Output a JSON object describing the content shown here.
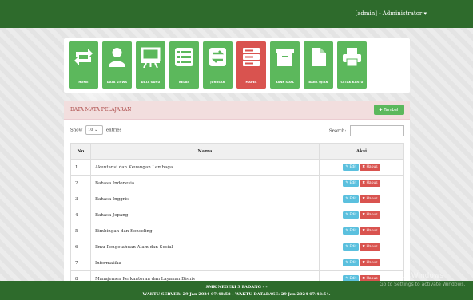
{
  "header": {
    "user_label": "[admin] - Administrator ▾"
  },
  "menu": [
    {
      "label": "HOME",
      "icon": "refresh-icon"
    },
    {
      "label": "DATA SISWA",
      "icon": "user-icon"
    },
    {
      "label": "DATA GURU",
      "icon": "presentation-icon"
    },
    {
      "label": "KELAS",
      "icon": "list-icon"
    },
    {
      "label": "JURUSAN",
      "icon": "transfer-icon"
    },
    {
      "label": "MAPEL",
      "icon": "server-icon"
    },
    {
      "label": "BANK SOAL",
      "icon": "archive-icon"
    },
    {
      "label": "BANK UJIAN",
      "icon": "file-icon"
    },
    {
      "label": "CETAK KARTU",
      "icon": "printer-icon"
    }
  ],
  "panel": {
    "title": "DATA MATA PELAJARAN",
    "add_label": "Tambah",
    "show_label": "Show",
    "entries_value": "10",
    "entries_label": "entries",
    "search_label": "Search:"
  },
  "table": {
    "headers": [
      "No",
      "Nama",
      "Aksi"
    ],
    "edit_label": "Edit",
    "hapus_label": "Hapus",
    "rows": [
      {
        "no": "1",
        "nama": "Akuntansi dan Keuangan Lembaga"
      },
      {
        "no": "2",
        "nama": "Bahasa Indonesia"
      },
      {
        "no": "3",
        "nama": "Bahasa Inggris"
      },
      {
        "no": "4",
        "nama": "Bahasa Jepang"
      },
      {
        "no": "5",
        "nama": "Bimbingan dan Konseling"
      },
      {
        "no": "6",
        "nama": "Ilmu Pengetahuan Alam dan Sosial"
      },
      {
        "no": "7",
        "nama": "Informatika"
      },
      {
        "no": "8",
        "nama": "Manajemen Perkantoran dan Layanan Bisnis"
      }
    ]
  },
  "footer": {
    "line1": "SMK NEGERI 3 PADANG - -",
    "line2": "WAKTU SERVER: 29 Jan 2024 07:48:58 - WAKTU DATABASE: 29 Jan 2024 07:48:54."
  },
  "watermark": {
    "line1": "Activate Windows",
    "line2": "Go to Settings to activate Windows."
  },
  "colors": {
    "brand_green": "#2e6b2c",
    "tile_green": "#5cb85c",
    "tile_red": "#d9534f",
    "edit": "#5bc0de"
  }
}
